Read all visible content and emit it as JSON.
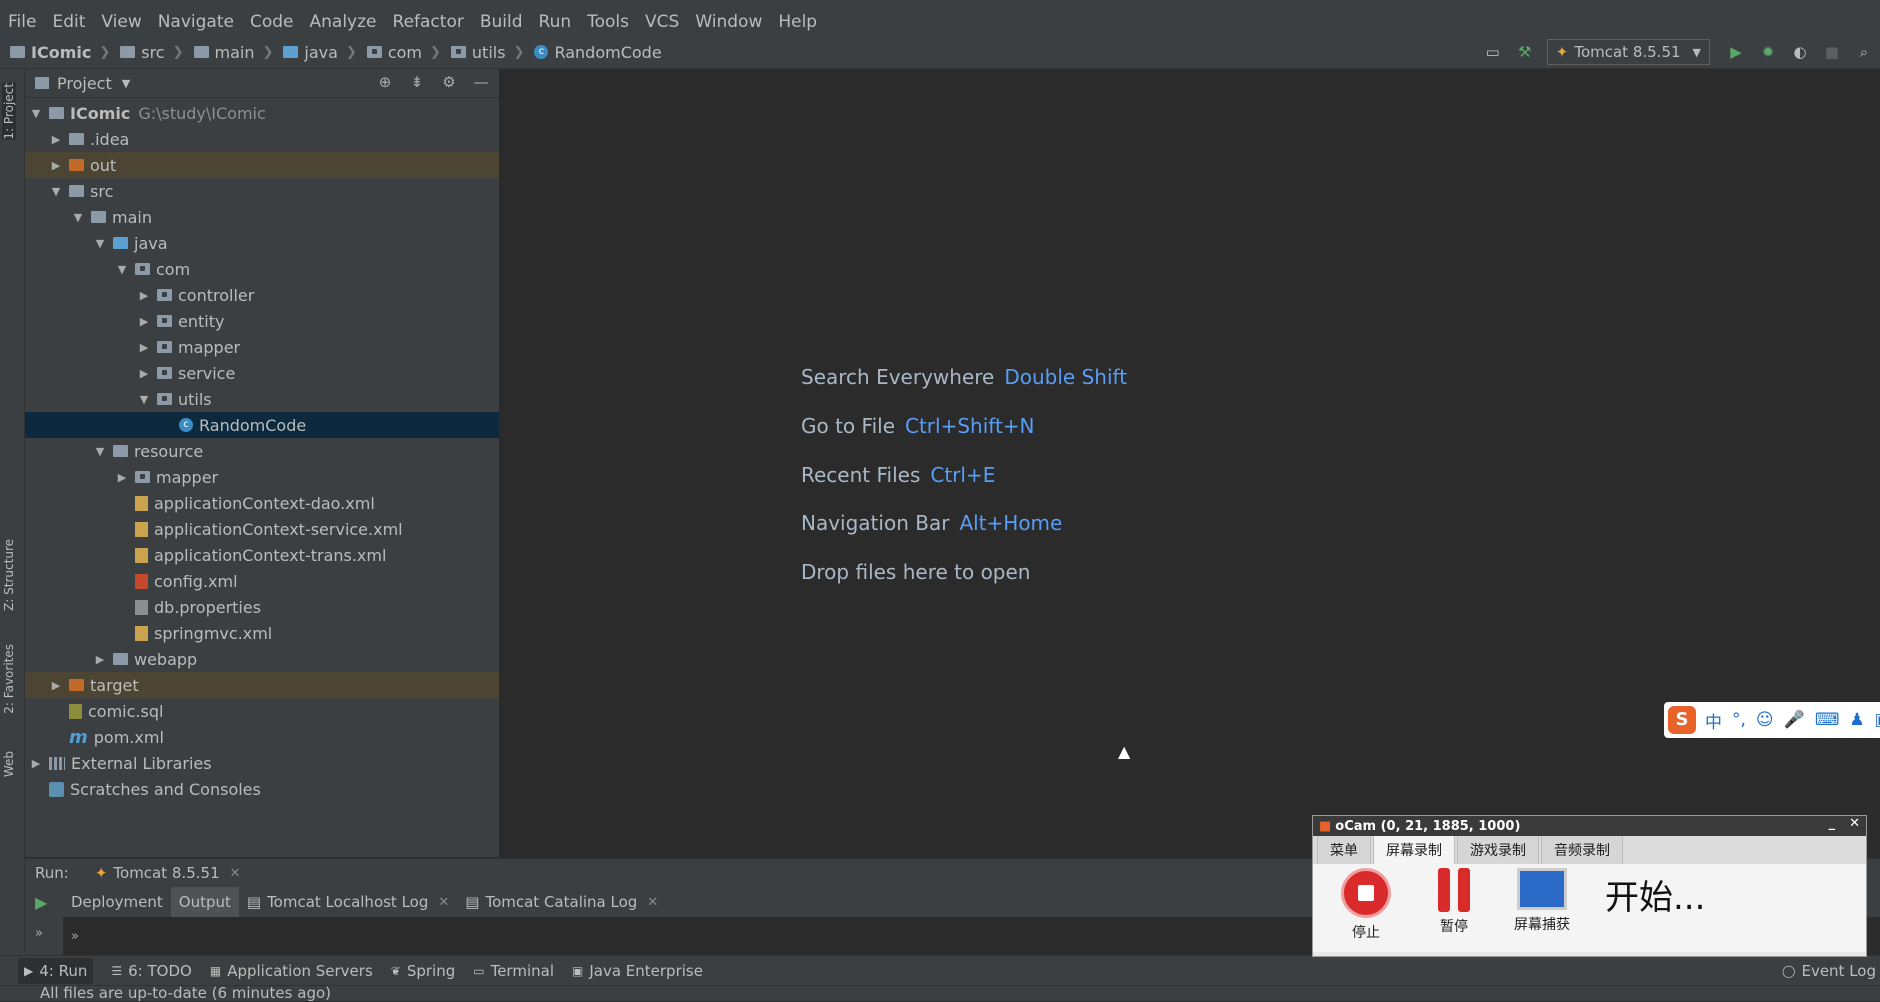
{
  "menu": [
    "File",
    "Edit",
    "View",
    "Navigate",
    "Code",
    "Analyze",
    "Refactor",
    "Build",
    "Run",
    "Tools",
    "VCS",
    "Window",
    "Help"
  ],
  "breadcrumb": [
    "IComic",
    "src",
    "main",
    "java",
    "com",
    "utils",
    "RandomCode"
  ],
  "run_config": "Tomcat 8.5.51",
  "project_panel": {
    "title": "Project",
    "root_name": "IComic",
    "root_path": "G:\\study\\IComic",
    "items": {
      "idea": ".idea",
      "out": "out",
      "src": "src",
      "main": "main",
      "java": "java",
      "com": "com",
      "controller": "controller",
      "entity": "entity",
      "mapper": "mapper",
      "service": "service",
      "utils": "utils",
      "randomcode": "RandomCode",
      "resource": "resource",
      "res_mapper": "mapper",
      "dao_xml": "applicationContext-dao.xml",
      "service_xml": "applicationContext-service.xml",
      "trans_xml": "applicationContext-trans.xml",
      "config_xml": "config.xml",
      "db_props": "db.properties",
      "springmvc_xml": "springmvc.xml",
      "webapp": "webapp",
      "target": "target",
      "comic_sql": "comic.sql",
      "pom_xml": "pom.xml",
      "ext_libs": "External Libraries",
      "scratches": "Scratches and Consoles"
    }
  },
  "side_tabs": {
    "project": "1: Project",
    "structure": "Z: Structure",
    "favorites": "2: Favorites",
    "web": "Web"
  },
  "editor_hints": [
    {
      "label": "Search Everywhere",
      "key": "Double Shift"
    },
    {
      "label": "Go to File",
      "key": "Ctrl+Shift+N"
    },
    {
      "label": "Recent Files",
      "key": "Ctrl+E"
    },
    {
      "label": "Navigation Bar",
      "key": "Alt+Home"
    },
    {
      "label": "Drop files here to open",
      "key": ""
    }
  ],
  "ime_toolbar": {
    "lang": "中",
    "punct": "°,"
  },
  "run_panel": {
    "label": "Run:",
    "tab": "Tomcat 8.5.51",
    "subtabs": [
      "Deployment",
      "Output",
      "Tomcat Localhost Log",
      "Tomcat Catalina Log"
    ]
  },
  "bottom_tools": [
    "4: Run",
    "6: TODO",
    "Application Servers",
    "Spring",
    "Terminal",
    "Java Enterprise"
  ],
  "event_log": "Event Log",
  "status": "All files are up-to-date (6 minutes ago)",
  "ocam": {
    "title": "oCam (0, 21, 1885, 1000)",
    "tabs": [
      "菜单",
      "屏幕录制",
      "游戏录制",
      "音频录制"
    ],
    "buttons": [
      "停止",
      "暂停",
      "屏幕捕获"
    ],
    "status": "开始..."
  }
}
